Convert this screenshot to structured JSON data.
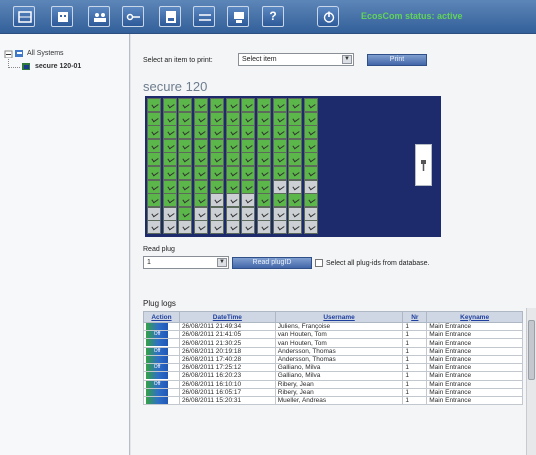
{
  "toolbar": {
    "buttons": [
      {
        "icon": "grid-icon"
      },
      {
        "icon": "calendar-icon"
      },
      {
        "icon": "users-icon"
      },
      {
        "icon": "key-icon"
      },
      {
        "icon": "document-icon"
      },
      {
        "icon": "transfer-icon"
      },
      {
        "icon": "user-settings-icon"
      },
      {
        "icon": "help-icon",
        "label": "?"
      },
      {
        "icon": "power-icon"
      }
    ],
    "status": "EcosCom status: active"
  },
  "tree": {
    "root_label": "All Systems",
    "child_label": "secure 120-01"
  },
  "print_bar": {
    "label": "Select an item to print:",
    "selected": "Select item",
    "button": "Print"
  },
  "panel_title": "secure 120",
  "plugs": {
    "rows": 10,
    "cols": 11,
    "states": [
      [
        1,
        1,
        1,
        1,
        1,
        1,
        1,
        1,
        1,
        1,
        1
      ],
      [
        1,
        1,
        1,
        1,
        1,
        1,
        1,
        1,
        1,
        1,
        1
      ],
      [
        1,
        1,
        1,
        1,
        1,
        1,
        1,
        1,
        1,
        1,
        1
      ],
      [
        1,
        1,
        1,
        1,
        1,
        1,
        1,
        1,
        1,
        1,
        1
      ],
      [
        1,
        1,
        1,
        1,
        1,
        1,
        1,
        1,
        1,
        1,
        1
      ],
      [
        1,
        1,
        1,
        1,
        1,
        1,
        1,
        1,
        1,
        1,
        1
      ],
      [
        1,
        1,
        1,
        1,
        1,
        1,
        1,
        1,
        0,
        0,
        0
      ],
      [
        1,
        1,
        1,
        1,
        0,
        0,
        0,
        1,
        1,
        1,
        1
      ],
      [
        0,
        0,
        1,
        0,
        0,
        0,
        0,
        0,
        0,
        0,
        0
      ],
      [
        0,
        0,
        0,
        0,
        0,
        0,
        0,
        0,
        0,
        0,
        0
      ]
    ]
  },
  "read_plug": {
    "label": "Read plug",
    "value": "1",
    "button": "Read plugID",
    "checkbox_label": "Select all plug-ids from database."
  },
  "logs": {
    "title": "Plug logs",
    "columns": [
      "Action",
      "DateTime",
      "Username",
      "Nr",
      "Keyname"
    ],
    "rows": [
      [
        "",
        "26/08/2011 21:49:34",
        "Juliens, Françoise",
        "1",
        "Main Entrance"
      ],
      [
        "Off",
        "26/08/2011 21:41:05",
        "van Houten, Tom",
        "1",
        "Main Entrance"
      ],
      [
        "",
        "26/08/2011 21:30:25",
        "van Houten, Tom",
        "1",
        "Main Entrance"
      ],
      [
        "Off",
        "26/08/2011 20:19:18",
        "Andersson, Thomas",
        "1",
        "Main Entrance"
      ],
      [
        "",
        "26/08/2011 17:40:28",
        "Andersson, Thomas",
        "1",
        "Main Entrance"
      ],
      [
        "Off",
        "26/08/2011 17:25:12",
        "Galliano, Milva",
        "1",
        "Main Entrance"
      ],
      [
        "",
        "26/08/2011 16:20:23",
        "Galliano, Milva",
        "1",
        "Main Entrance"
      ],
      [
        "Off",
        "26/08/2011 16:10:10",
        "Ribery, Jean",
        "1",
        "Main Entrance"
      ],
      [
        "",
        "26/08/2011 16:05:17",
        "Ribery, Jean",
        "1",
        "Main Entrance"
      ],
      [
        "",
        "26/08/2011 15:20:31",
        "Mueller, Andreas",
        "1",
        "Main Entrance"
      ]
    ]
  }
}
